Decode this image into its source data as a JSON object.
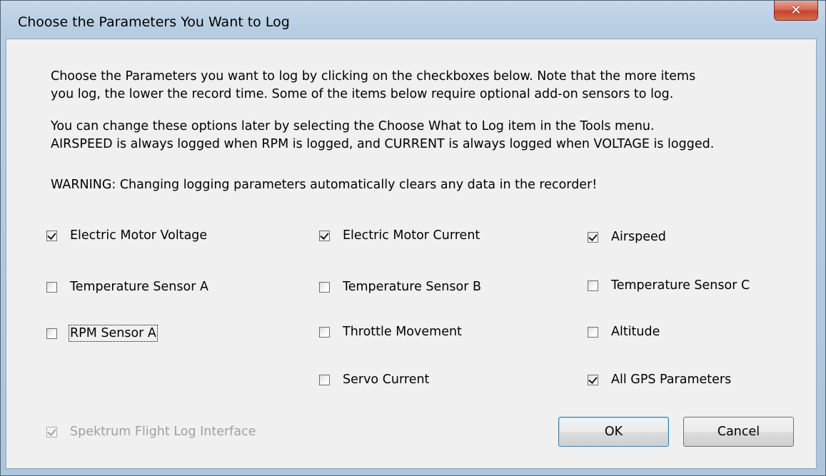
{
  "window": {
    "title": "Choose the Parameters You Want to Log",
    "close_glyph": "✕"
  },
  "description": {
    "line1": "Choose the Parameters you want to log by clicking on the checkboxes below.   Note that the more items",
    "line2": "you log, the lower the record time.   Some of the items below require optional add-on sensors to log.",
    "line3": "You can change these options later by selecting the Choose What to Log item in the Tools menu.",
    "line4": "AIRSPEED is always logged when RPM is logged, and CURRENT is always logged when VOLTAGE is logged.",
    "warning": "WARNING: Changing logging parameters automatically clears any data in the recorder!"
  },
  "parameters": [
    {
      "label": "Electric Motor Voltage",
      "checked": true
    },
    {
      "label": "Electric Motor Current",
      "checked": true
    },
    {
      "label": "Airspeed",
      "checked": true
    },
    {
      "label": "Temperature Sensor A",
      "checked": false
    },
    {
      "label": "Temperature Sensor B",
      "checked": false
    },
    {
      "label": "Temperature Sensor C",
      "checked": false
    },
    {
      "label": "RPM Sensor A",
      "checked": false,
      "focused": true
    },
    {
      "label": "Throttle Movement",
      "checked": false
    },
    {
      "label": "Altitude",
      "checked": false
    },
    {
      "label": "Servo Current",
      "checked": false
    },
    {
      "label": "All GPS Parameters",
      "checked": true
    }
  ],
  "spektrum": {
    "label": "Spektrum Flight Log Interface",
    "checked": true,
    "disabled": true
  },
  "buttons": {
    "ok": "OK",
    "cancel": "Cancel"
  }
}
